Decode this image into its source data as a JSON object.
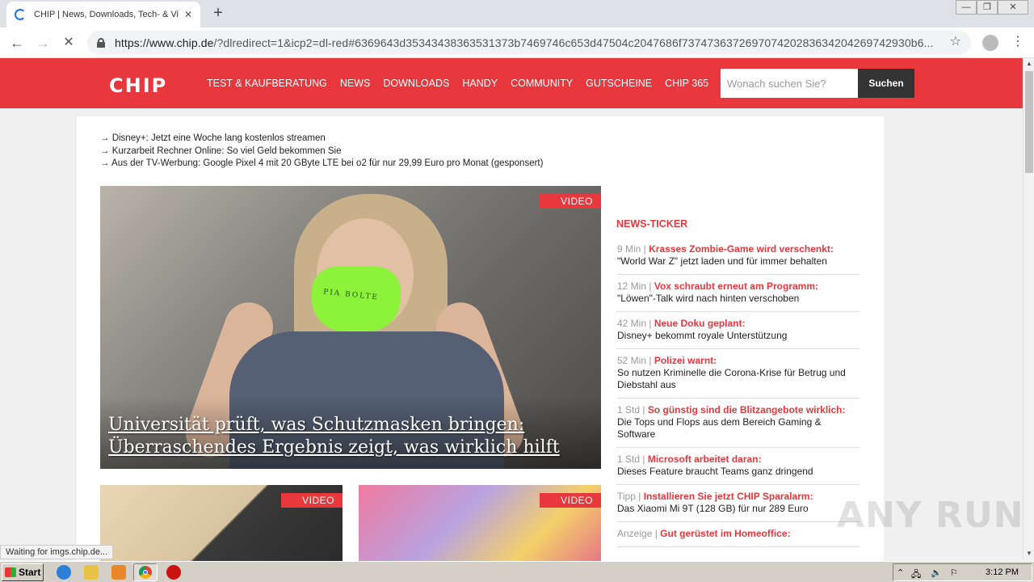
{
  "browser": {
    "tab_title": "CHIP | News, Downloads, Tech- & Vi",
    "tab_close": "✕",
    "new_tab": "+",
    "url_host": "https://www.chip.de",
    "url_path": "/?dlredirect=1&icp2=dl-red#6369643d35343438363531373b7469746c653d47504c2047686f737473637269707420283634204269742930b6...",
    "window_controls": [
      "—",
      "❐",
      "✕"
    ],
    "status_text": "Waiting for imgs.chip.de..."
  },
  "site": {
    "logo": "CHIP",
    "nav": [
      "TEST & KAUFBERATUNG",
      "NEWS",
      "DOWNLOADS",
      "HANDY",
      "COMMUNITY",
      "GUTSCHEINE",
      "CHIP 365"
    ],
    "search_placeholder": "Wonach suchen Sie?",
    "search_button": "Suchen",
    "accent": "#e8383d"
  },
  "quicklinks": [
    "→ Disney+: Jetzt eine Woche lang kostenlos streamen",
    "→ Kurzarbeit Rechner Online: So viel Geld bekommen Sie",
    "→ Aus der TV-Werbung: Google Pixel 4 mit 20 GByte LTE bei o2 für nur 29,99 Euro pro Monat (gesponsert)"
  ],
  "hero": {
    "badge": "VIDEO",
    "title": "Universität prüft, was Schutzmasken bringen: Überraschendes Ergebnis zeigt, was wirklich hilft",
    "mask_text": "PIA BOLTE"
  },
  "cards": [
    {
      "badge": "VIDEO"
    },
    {
      "badge": "VIDEO"
    }
  ],
  "ticker": {
    "title": "NEWS-TICKER",
    "items": [
      {
        "time": "9 Min",
        "headline": "Krasses Zombie-Game wird verschenkt:",
        "sub": "\"World War Z\" jetzt laden und für immer behalten"
      },
      {
        "time": "12 Min",
        "headline": "Vox schraubt erneut am Programm:",
        "sub": "\"Löwen\"-Talk wird nach hinten verschoben"
      },
      {
        "time": "42 Min",
        "headline": "Neue Doku geplant:",
        "sub": "Disney+ bekommt royale Unterstützung"
      },
      {
        "time": "52 Min",
        "headline": "Polizei warnt:",
        "sub": "So nutzen Kriminelle die Corona-Krise für Betrug und Diebstahl aus"
      },
      {
        "time": "1 Std",
        "headline": "So günstig sind die Blitzangebote wirklich:",
        "sub": "Die Tops und Flops aus dem Bereich Gaming & Software"
      },
      {
        "time": "1 Std",
        "headline": "Microsoft arbeitet daran:",
        "sub": "Dieses Feature braucht Teams ganz dringend"
      },
      {
        "time": "Tipp",
        "headline": "Installieren Sie jetzt CHIP Sparalarm:",
        "sub": "Das Xiaomi Mi 9T (128 GB) für nur 289 Euro"
      },
      {
        "time": "Anzeige",
        "headline": "Gut gerüstet im Homeoffice:",
        "sub": ""
      }
    ]
  },
  "watermark": "ANY RUN",
  "taskbar": {
    "start_label": "Start",
    "clock": "3:12 PM"
  }
}
